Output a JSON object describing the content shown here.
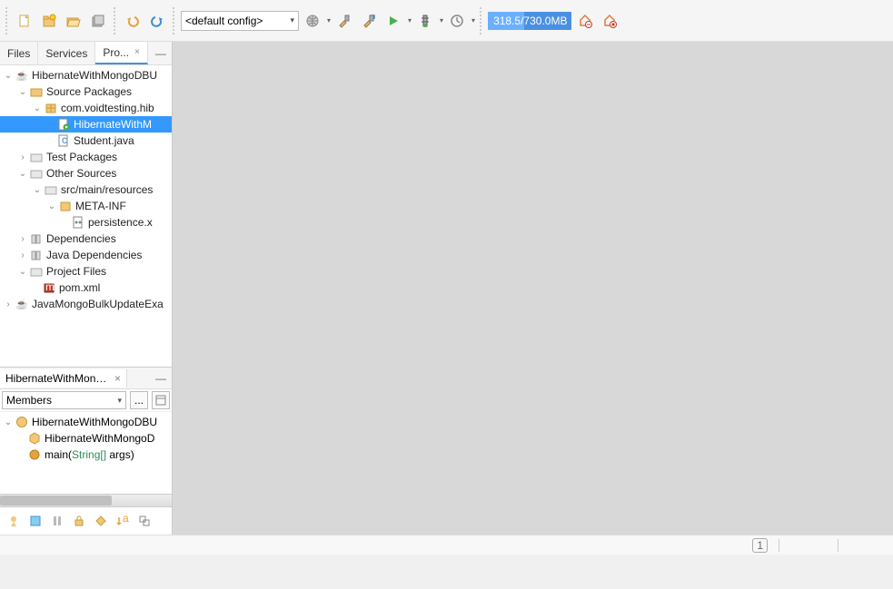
{
  "toolbar": {
    "config_selected": "<default config>",
    "memory_text": "318.5/730.0MB"
  },
  "tabs": {
    "files": "Files",
    "services": "Services",
    "projects": "Pro..."
  },
  "tree": {
    "root1": "HibernateWithMongoDBU",
    "source_packages": "Source Packages",
    "pkg": "com.voidtesting.hib",
    "file1": "HibernateWithM",
    "file2": "Student.java",
    "test_packages": "Test Packages",
    "other_sources": "Other Sources",
    "resources": "src/main/resources",
    "metainf": "META-INF",
    "persistence": "persistence.x",
    "deps": "Dependencies",
    "jdeps": "Java Dependencies",
    "pfiles": "Project Files",
    "pom": "pom.xml",
    "root2": "JavaMongoBulkUpdateExa"
  },
  "navigator": {
    "tab_label": "HibernateWithMongo...",
    "members": "Members",
    "ellipsis": "...",
    "cls": "HibernateWithMongoDBU",
    "ctor": "HibernateWithMongoD",
    "main_method": "main",
    "main_args": "String[] ",
    "args_suffix": "args)"
  },
  "status": {
    "indicator": "1"
  }
}
